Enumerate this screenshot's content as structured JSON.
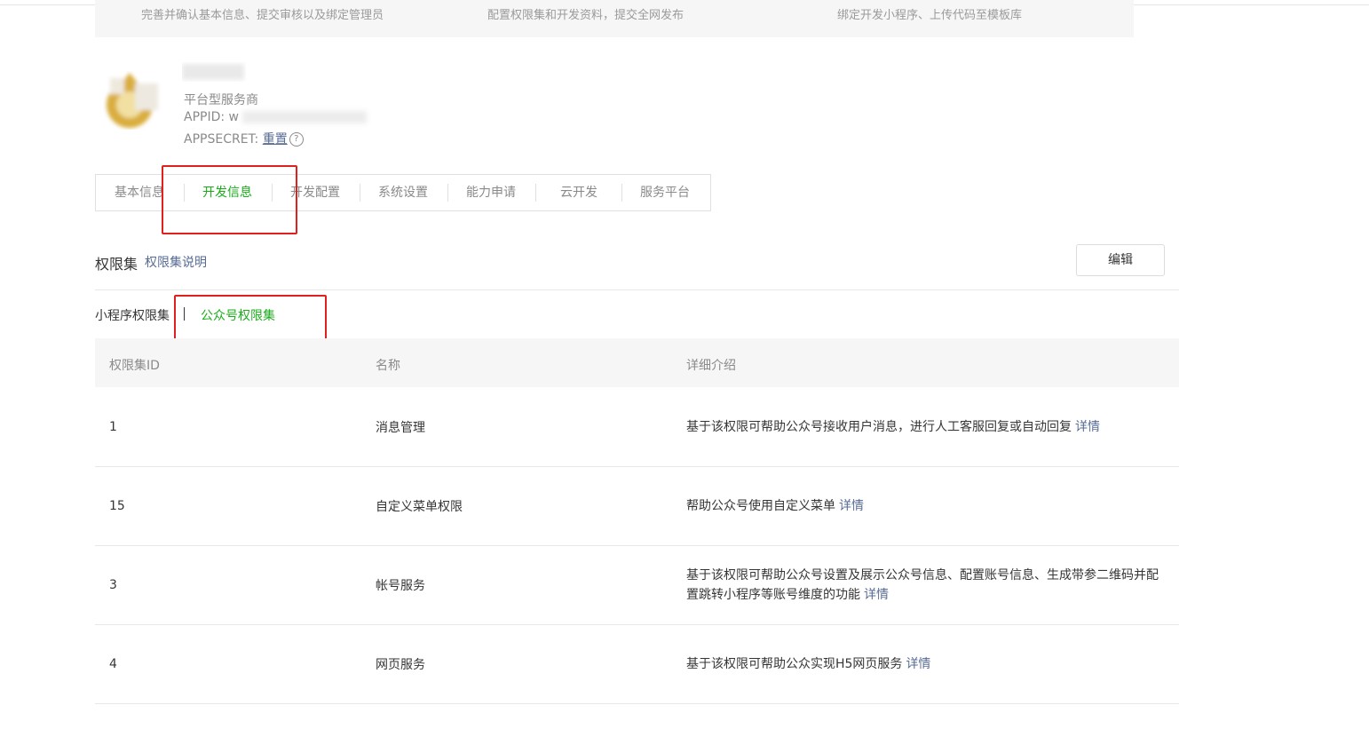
{
  "steps": [
    "完善并确认基本信息、提交审核以及绑定管理员",
    "配置权限集和开发资料，提交全网发布",
    "绑定开发小程序、上传代码至模板库"
  ],
  "account": {
    "type": "平台型服务商",
    "appid_label": "APPID: w",
    "secret_label": "APPSECRET:",
    "reset_link": "重置",
    "help_icon": "?"
  },
  "tabs": [
    "基本信息",
    "开发信息",
    "开发配置",
    "系统设置",
    "能力申请",
    "云开发",
    "服务平台"
  ],
  "active_tab": "开发信息",
  "section": {
    "title": "权限集",
    "link": "权限集说明",
    "edit_button": "编辑"
  },
  "subtabs": {
    "miniprogram": "小程序权限集",
    "official": "公众号权限集"
  },
  "table": {
    "headers": [
      "权限集ID",
      "名称",
      "详细介绍"
    ],
    "detail_link": "详情",
    "rows": [
      {
        "id": "1",
        "name": "消息管理",
        "desc": "基于该权限可帮助公众号接收用户消息，进行人工客服回复或自动回复"
      },
      {
        "id": "15",
        "name": "自定义菜单权限",
        "desc": "帮助公众号使用自定义菜单"
      },
      {
        "id": "3",
        "name": "帐号服务",
        "desc": "基于该权限可帮助公众号设置及展示公众号信息、配置账号信息、生成带参二维码并配置跳转小程序等账号维度的功能"
      },
      {
        "id": "4",
        "name": "网页服务",
        "desc": "基于该权限可帮助公众实现H5网页服务"
      }
    ]
  },
  "colors": {
    "accent": "#1aad19",
    "link": "#576b95",
    "highlight": "#e0201c"
  }
}
